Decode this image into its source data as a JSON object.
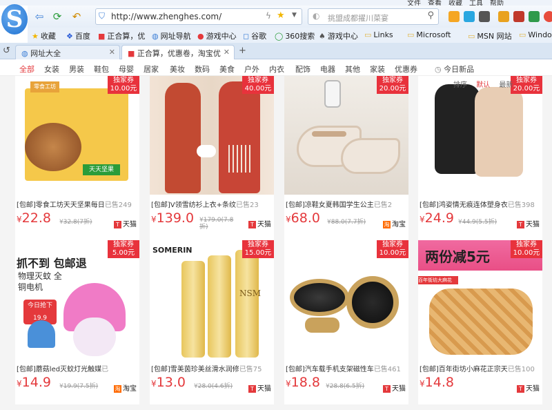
{
  "menu": [
    "文件",
    "查看",
    "收藏",
    "工具",
    "帮助"
  ],
  "address": {
    "url": "http://www.zhenghes.com/"
  },
  "search": {
    "placeholder": "挑盟成都擢川菜宴"
  },
  "bookmarks": [
    "收藏",
    "百度",
    "正合算，优",
    "网址导航",
    "游戏中心",
    "谷歌",
    "360搜索",
    "游戏中心",
    "Links",
    "Microsoft",
    "MSN 网站",
    "Windows L"
  ],
  "tabs": [
    {
      "label": "网址大全"
    },
    {
      "label": "正合算，优惠卷，淘宝优"
    }
  ],
  "categories": [
    "全部",
    "女装",
    "男装",
    "鞋包",
    "母婴",
    "居家",
    "美妆",
    "数码",
    "美食",
    "户外",
    "内衣",
    "配饰",
    "电器",
    "其他",
    "家装",
    "优惠券",
    "今日新品"
  ],
  "sort": [
    "排序",
    "默认",
    "最新"
  ],
  "colors": {
    "accent": "#e4393c",
    "tmall": "#e4393c",
    "taobao": "#ff6a00"
  },
  "coupon_label": "独家券",
  "products": [
    {
      "title": "[包邮]零食工坊天天坚果每日",
      "sold": "已售249",
      "price": "22.8",
      "orig": "32.8(7折)",
      "shop": "天猫",
      "coupon": "10.00元",
      "img_text": "零食工坊",
      "img_text2": "天天坚果"
    },
    {
      "title": "[包邮]V领雪纺衫上衣+条纹",
      "sold": "已售23",
      "price": "139.0",
      "orig": "179.0(7.8折)",
      "shop": "天猫",
      "coupon": "40.00元",
      "img_text": "",
      "img_text2": ""
    },
    {
      "title": "[包邮]凉鞋女夏韩国学生公主",
      "sold": "已售2",
      "price": "68.0",
      "orig": "88.0(7.7折)",
      "shop": "淘宝",
      "coupon": "20.00元",
      "img_text": "",
      "img_text2": ""
    },
    {
      "title": "[包邮]鸿姿情无痕连体塑身衣",
      "sold": "已售398",
      "price": "24.9",
      "orig": "44.9(5.5折)",
      "shop": "天猫",
      "coupon": "20.00元",
      "img_text": "",
      "img_text2": ""
    },
    {
      "title": "[包邮]蘑菇led灭蚊灯光触媒",
      "sold": "已",
      "price": "14.9",
      "orig": "19.9(7.5折)",
      "shop": "淘宝",
      "coupon": "5.00元",
      "img_text": "抓不到 包邮退",
      "img_text2": "物理灭蚊 全铜电机",
      "img_text3": "今日抢下 19.9"
    },
    {
      "title": "[包邮]雪美茵珍美丝滑水润修",
      "sold": "已售75",
      "price": "13.0",
      "orig": "28.0(4.6折)",
      "shop": "天猫",
      "coupon": "15.00元",
      "img_text": "SOMERIN",
      "img_text2": "NSM"
    },
    {
      "title": "[包邮]汽车载手机支架磁性车",
      "sold": "已售461",
      "price": "18.8",
      "orig": "28.8(6.5折)",
      "shop": "天猫",
      "coupon": "10.00元",
      "img_text": "",
      "img_text2": ""
    },
    {
      "title": "[包邮]百年街坊小麻花正宗天",
      "sold": "已售100",
      "price": "14.8",
      "orig": "",
      "shop": "天猫",
      "coupon": "10.00元",
      "img_text": "两份减5元",
      "img_text2": "百年街坊大麻花"
    }
  ]
}
